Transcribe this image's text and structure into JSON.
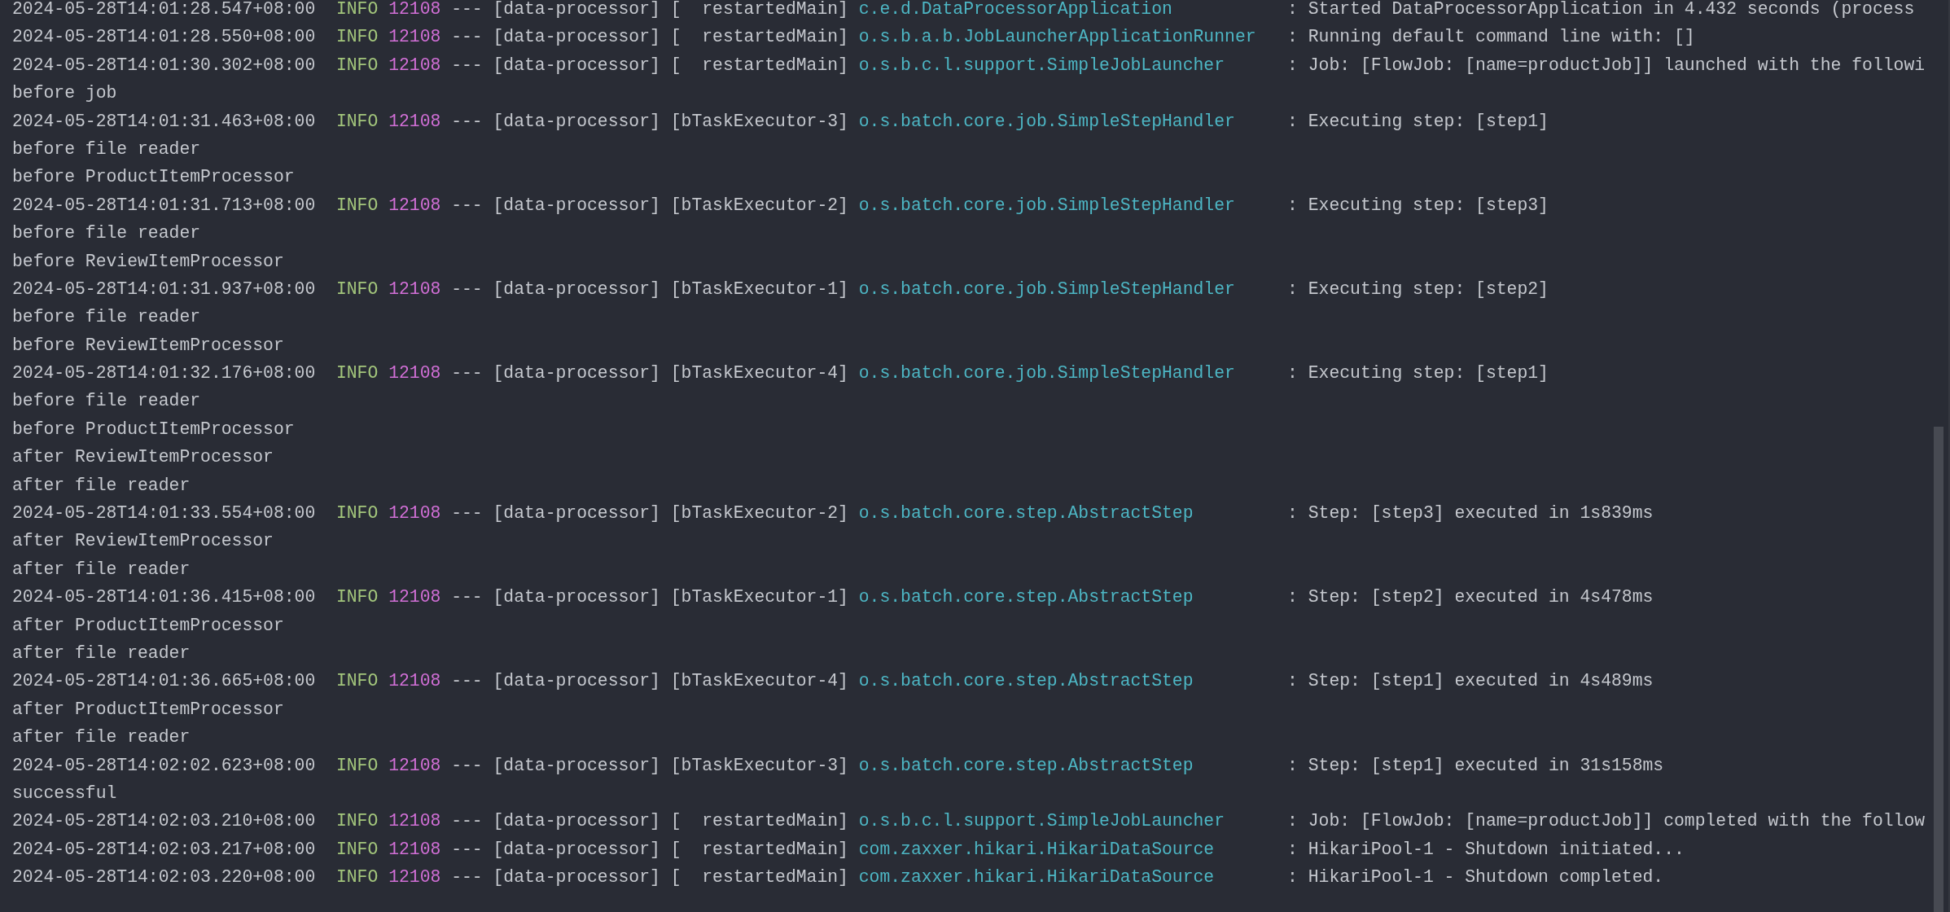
{
  "console": {
    "lines": [
      {
        "kind": "log",
        "timestamp": "2024-05-28T14:01:28.547+08:00",
        "level": "INFO",
        "pid": "12108",
        "dashes": "---",
        "app": "[data-processor]",
        "thread": "[  restartedMain]",
        "logger": "c.e.d.DataProcessorApplication",
        "colon": ":",
        "message": "Started DataProcessorApplication in 4.432 seconds (process"
      },
      {
        "kind": "log",
        "timestamp": "2024-05-28T14:01:28.550+08:00",
        "level": "INFO",
        "pid": "12108",
        "dashes": "---",
        "app": "[data-processor]",
        "thread": "[  restartedMain]",
        "logger": "o.s.b.a.b.JobLauncherApplicationRunner",
        "colon": ":",
        "message": "Running default command line with: []"
      },
      {
        "kind": "log",
        "timestamp": "2024-05-28T14:01:30.302+08:00",
        "level": "INFO",
        "pid": "12108",
        "dashes": "---",
        "app": "[data-processor]",
        "thread": "[  restartedMain]",
        "logger": "o.s.b.c.l.support.SimpleJobLauncher",
        "colon": ":",
        "message": "Job: [FlowJob: [name=productJob]] launched with the followi"
      },
      {
        "kind": "text",
        "text": "before job"
      },
      {
        "kind": "log",
        "timestamp": "2024-05-28T14:01:31.463+08:00",
        "level": "INFO",
        "pid": "12108",
        "dashes": "---",
        "app": "[data-processor]",
        "thread": "[bTaskExecutor-3]",
        "logger": "o.s.batch.core.job.SimpleStepHandler",
        "colon": ":",
        "message": "Executing step: [step1]"
      },
      {
        "kind": "text",
        "text": "before file reader"
      },
      {
        "kind": "text",
        "text": "before ProductItemProcessor"
      },
      {
        "kind": "log",
        "timestamp": "2024-05-28T14:01:31.713+08:00",
        "level": "INFO",
        "pid": "12108",
        "dashes": "---",
        "app": "[data-processor]",
        "thread": "[bTaskExecutor-2]",
        "logger": "o.s.batch.core.job.SimpleStepHandler",
        "colon": ":",
        "message": "Executing step: [step3]"
      },
      {
        "kind": "text",
        "text": "before file reader"
      },
      {
        "kind": "text",
        "text": "before ReviewItemProcessor"
      },
      {
        "kind": "log",
        "timestamp": "2024-05-28T14:01:31.937+08:00",
        "level": "INFO",
        "pid": "12108",
        "dashes": "---",
        "app": "[data-processor]",
        "thread": "[bTaskExecutor-1]",
        "logger": "o.s.batch.core.job.SimpleStepHandler",
        "colon": ":",
        "message": "Executing step: [step2]"
      },
      {
        "kind": "text",
        "text": "before file reader"
      },
      {
        "kind": "text",
        "text": "before ReviewItemProcessor"
      },
      {
        "kind": "log",
        "timestamp": "2024-05-28T14:01:32.176+08:00",
        "level": "INFO",
        "pid": "12108",
        "dashes": "---",
        "app": "[data-processor]",
        "thread": "[bTaskExecutor-4]",
        "logger": "o.s.batch.core.job.SimpleStepHandler",
        "colon": ":",
        "message": "Executing step: [step1]"
      },
      {
        "kind": "text",
        "text": "before file reader"
      },
      {
        "kind": "text",
        "text": "before ProductItemProcessor"
      },
      {
        "kind": "text",
        "text": "after ReviewItemProcessor"
      },
      {
        "kind": "text",
        "text": "after file reader"
      },
      {
        "kind": "log",
        "timestamp": "2024-05-28T14:01:33.554+08:00",
        "level": "INFO",
        "pid": "12108",
        "dashes": "---",
        "app": "[data-processor]",
        "thread": "[bTaskExecutor-2]",
        "logger": "o.s.batch.core.step.AbstractStep",
        "colon": ":",
        "message": "Step: [step3] executed in 1s839ms"
      },
      {
        "kind": "text",
        "text": "after ReviewItemProcessor"
      },
      {
        "kind": "text",
        "text": "after file reader"
      },
      {
        "kind": "log",
        "timestamp": "2024-05-28T14:01:36.415+08:00",
        "level": "INFO",
        "pid": "12108",
        "dashes": "---",
        "app": "[data-processor]",
        "thread": "[bTaskExecutor-1]",
        "logger": "o.s.batch.core.step.AbstractStep",
        "colon": ":",
        "message": "Step: [step2] executed in 4s478ms"
      },
      {
        "kind": "text",
        "text": "after ProductItemProcessor"
      },
      {
        "kind": "text",
        "text": "after file reader"
      },
      {
        "kind": "log",
        "timestamp": "2024-05-28T14:01:36.665+08:00",
        "level": "INFO",
        "pid": "12108",
        "dashes": "---",
        "app": "[data-processor]",
        "thread": "[bTaskExecutor-4]",
        "logger": "o.s.batch.core.step.AbstractStep",
        "colon": ":",
        "message": "Step: [step1] executed in 4s489ms"
      },
      {
        "kind": "text",
        "text": "after ProductItemProcessor"
      },
      {
        "kind": "text",
        "text": "after file reader"
      },
      {
        "kind": "log",
        "timestamp": "2024-05-28T14:02:02.623+08:00",
        "level": "INFO",
        "pid": "12108",
        "dashes": "---",
        "app": "[data-processor]",
        "thread": "[bTaskExecutor-3]",
        "logger": "o.s.batch.core.step.AbstractStep",
        "colon": ":",
        "message": "Step: [step1] executed in 31s158ms"
      },
      {
        "kind": "text",
        "text": "successful"
      },
      {
        "kind": "log",
        "timestamp": "2024-05-28T14:02:03.210+08:00",
        "level": "INFO",
        "pid": "12108",
        "dashes": "---",
        "app": "[data-processor]",
        "thread": "[  restartedMain]",
        "logger": "o.s.b.c.l.support.SimpleJobLauncher",
        "colon": ":",
        "message": "Job: [FlowJob: [name=productJob]] completed with the follow"
      },
      {
        "kind": "log",
        "timestamp": "2024-05-28T14:02:03.217+08:00",
        "level": "INFO",
        "pid": "12108",
        "dashes": "---",
        "app": "[data-processor]",
        "thread": "[  restartedMain]",
        "logger": "com.zaxxer.hikari.HikariDataSource",
        "colon": ":",
        "message": "HikariPool-1 - Shutdown initiated..."
      },
      {
        "kind": "log",
        "timestamp": "2024-05-28T14:02:03.220+08:00",
        "level": "INFO",
        "pid": "12108",
        "dashes": "---",
        "app": "[data-processor]",
        "thread": "[  restartedMain]",
        "logger": "com.zaxxer.hikari.HikariDataSource",
        "colon": ":",
        "message": "HikariPool-1 - Shutdown completed."
      }
    ]
  }
}
